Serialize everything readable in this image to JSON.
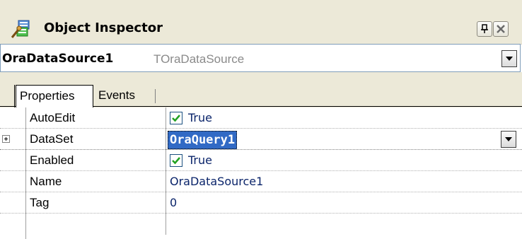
{
  "window": {
    "title": "Object Inspector",
    "icon": "object-inspector-icon"
  },
  "selector": {
    "object_name": "OraDataSource1",
    "object_type": "TOraDataSource"
  },
  "tabs": [
    {
      "label": "Properties",
      "active": true
    },
    {
      "label": "Events",
      "active": false
    }
  ],
  "properties": [
    {
      "name": "AutoEdit",
      "value": "True",
      "type": "boolean",
      "checked": true
    },
    {
      "name": "DataSet",
      "value": "OraQuery1",
      "type": "dropdown",
      "expandable": true,
      "selected": true
    },
    {
      "name": "Enabled",
      "value": "True",
      "type": "boolean",
      "checked": true
    },
    {
      "name": "Name",
      "value": "OraDataSource1",
      "type": "text"
    },
    {
      "name": "Tag",
      "value": "0",
      "type": "text"
    }
  ],
  "colors": {
    "chrome": "#ece9d8",
    "value_text": "#0a246a",
    "selection": "#316ac5",
    "checkmark": "#21a121"
  }
}
